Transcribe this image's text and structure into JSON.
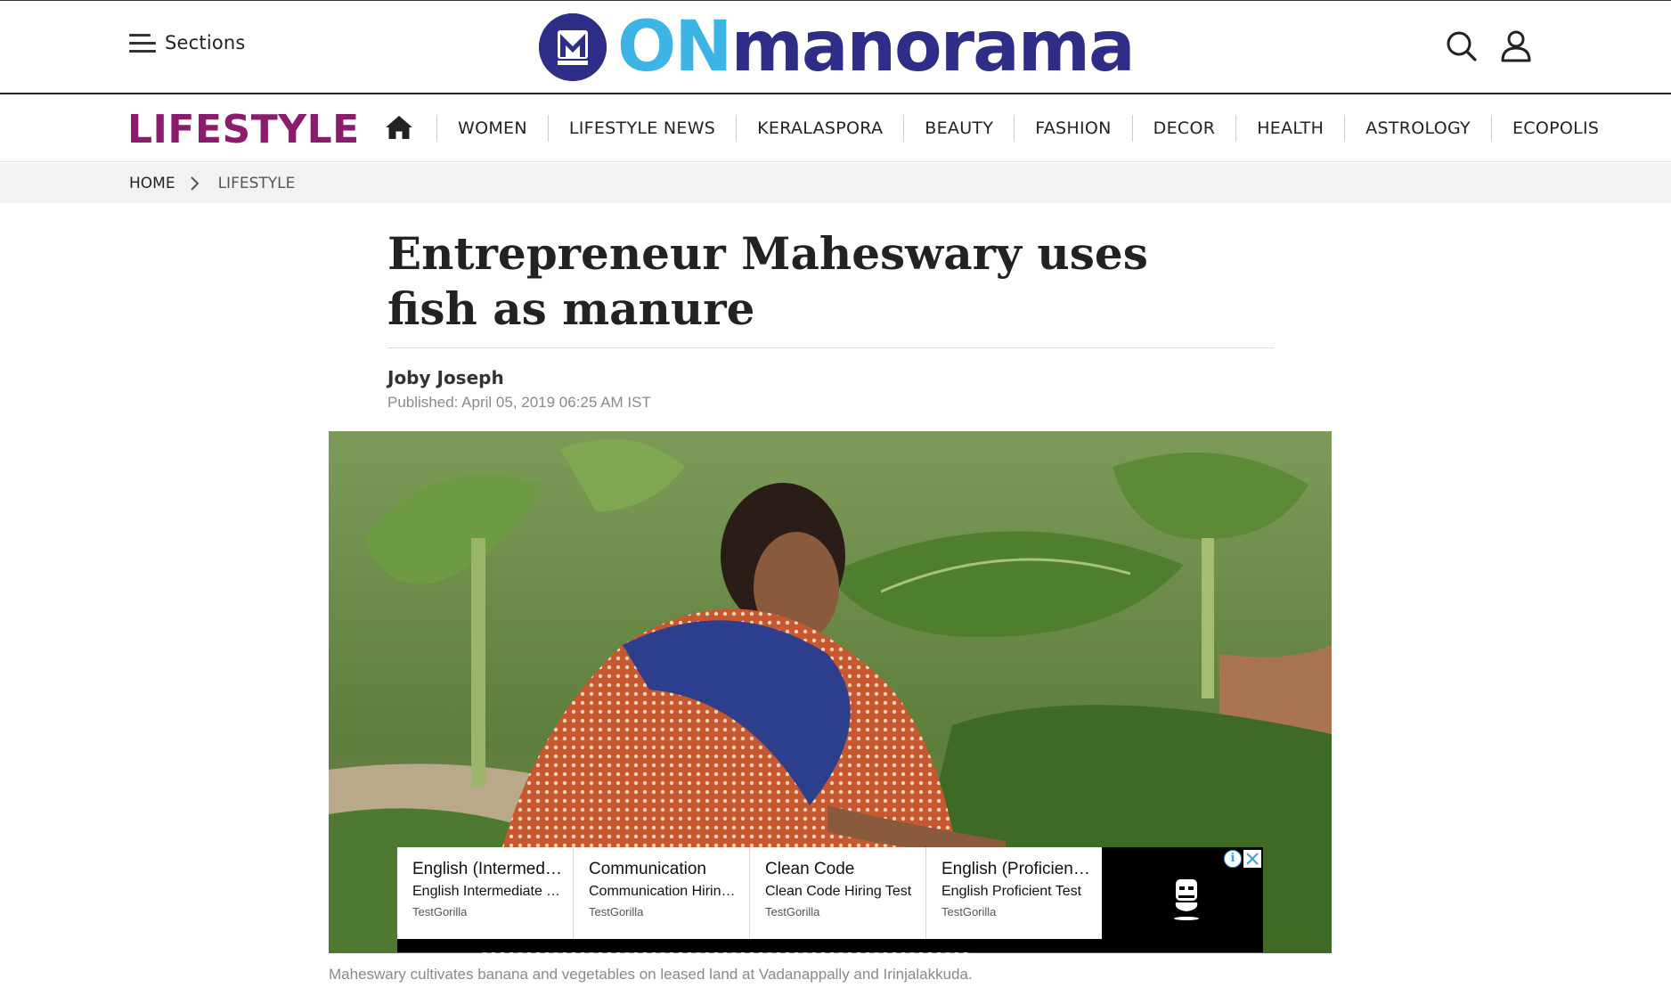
{
  "header": {
    "sections_label": "Sections",
    "logo": {
      "on": "ON",
      "rest": "manorama"
    },
    "colors": {
      "logo_dark": "#2e2d88",
      "logo_light": "#3cb4e6"
    }
  },
  "nav": {
    "brand": "LIFESTYLE",
    "brand_color": "#8b1c6d",
    "items": [
      {
        "label": "WOMEN"
      },
      {
        "label": "LIFESTYLE NEWS"
      },
      {
        "label": "KERALASPORA"
      },
      {
        "label": "BEAUTY"
      },
      {
        "label": "FASHION"
      },
      {
        "label": "DECOR"
      },
      {
        "label": "HEALTH"
      },
      {
        "label": "ASTROLOGY"
      },
      {
        "label": "ECOPOLIS"
      }
    ]
  },
  "breadcrumb": {
    "home": "HOME",
    "current": "LIFESTYLE"
  },
  "article": {
    "headline": "Entrepreneur Maheswary uses fish as manure",
    "author": "Joby Joseph",
    "published": "Published: April 05, 2019 06:25 AM IST",
    "caption": "Maheswary cultivates banana and vegetables on leased land at Vadanappally and Irinjalakkuda."
  },
  "ad": {
    "cards": [
      {
        "title": "English (Intermediate)",
        "subtitle": "English Intermediate Test",
        "source": "TestGorilla"
      },
      {
        "title": "Communication",
        "subtitle": "Communication Hiring Test",
        "source": "TestGorilla"
      },
      {
        "title": "Clean Code",
        "subtitle": "Clean Code Hiring Test",
        "source": "TestGorilla"
      },
      {
        "title": "English (Proficient/Advanced)",
        "subtitle": "English Proficient Test",
        "source": "TestGorilla"
      }
    ],
    "info_symbol": "i"
  }
}
